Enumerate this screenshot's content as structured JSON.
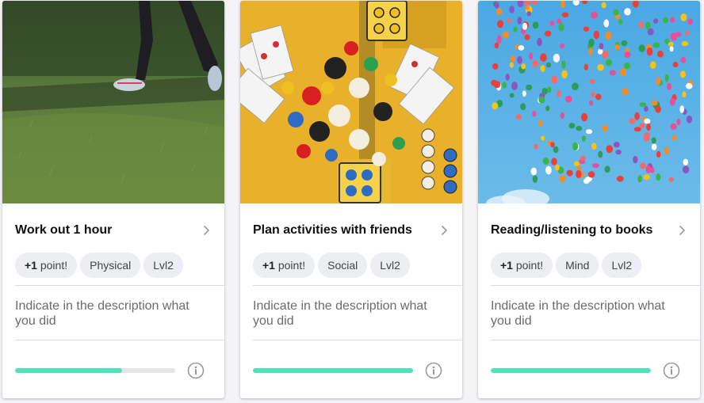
{
  "cards": [
    {
      "title": "Work out 1 hour",
      "points_value": "+1",
      "points_label": " point!",
      "category": "Physical",
      "level": "Lvl2",
      "description": "Indicate in the description what you did",
      "progress": 0.67,
      "image_subject": "person walking on grass"
    },
    {
      "title": "Plan activities with friends",
      "points_value": "+1",
      "points_label": " point!",
      "category": "Social",
      "level": "Lvl2",
      "description": "Indicate in the description what you did",
      "progress": 1.0,
      "image_subject": "board game pieces and playing cards"
    },
    {
      "title": "Reading/listening to books",
      "points_value": "+1",
      "points_label": " point!",
      "category": "Mind",
      "level": "Lvl2",
      "description": "Indicate in the description what you did",
      "progress": 1.0,
      "image_subject": "colorful balloons in blue sky"
    }
  ],
  "colors": {
    "progress_fill": "#4fe3b9",
    "progress_track": "#e5e5e5",
    "tag_bg": "#eceef1",
    "page_bg": "#f4f4f6"
  },
  "icons": [
    "chevron-right-icon",
    "info-icon"
  ]
}
